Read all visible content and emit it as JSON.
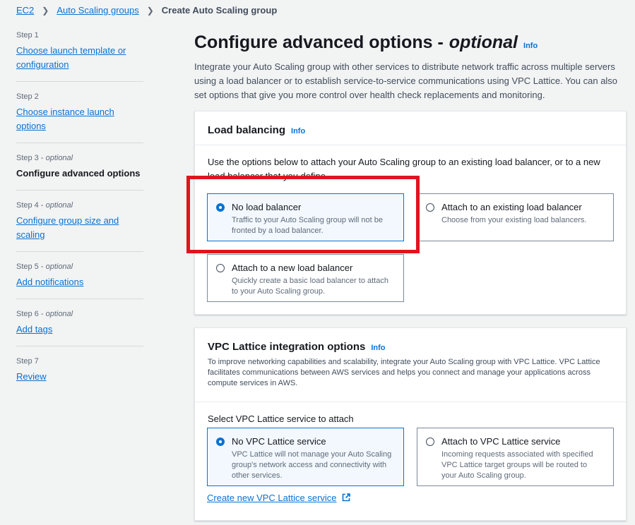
{
  "breadcrumb": {
    "items": [
      "EC2",
      "Auto Scaling groups"
    ],
    "current": "Create Auto Scaling group"
  },
  "steps": [
    {
      "num": "Step 1",
      "optional": "",
      "label": "Choose launch template or configuration"
    },
    {
      "num": "Step 2",
      "optional": "",
      "label": "Choose instance launch options"
    },
    {
      "num": "Step 3 - ",
      "optional": "optional",
      "label": "Configure advanced options"
    },
    {
      "num": "Step 4 - ",
      "optional": "optional",
      "label": "Configure group size and scaling"
    },
    {
      "num": "Step 5 - ",
      "optional": "optional",
      "label": "Add notifications"
    },
    {
      "num": "Step 6 - ",
      "optional": "optional",
      "label": "Add tags"
    },
    {
      "num": "Step 7",
      "optional": "",
      "label": "Review"
    }
  ],
  "page": {
    "title": "Configure advanced options -",
    "title_optional": "optional",
    "info": "Info",
    "description": "Integrate your Auto Scaling group with other services to distribute network traffic across multiple servers using a load balancer or to establish service-to-service communications using VPC Lattice. You can also set options that give you more control over health check replacements and monitoring."
  },
  "load_balancing": {
    "title": "Load balancing",
    "info": "Info",
    "intro": "Use the options below to attach your Auto Scaling group to an existing load balancer, or to a new load balancer that you define.",
    "options": [
      {
        "title": "No load balancer",
        "desc": "Traffic to your Auto Scaling group will not be fronted by a load balancer.",
        "selected": true
      },
      {
        "title": "Attach to an existing load balancer",
        "desc": "Choose from your existing load balancers.",
        "selected": false
      },
      {
        "title": "Attach to a new load balancer",
        "desc": "Quickly create a basic load balancer to attach to your Auto Scaling group.",
        "selected": false
      }
    ]
  },
  "vpc_lattice": {
    "title": "VPC Lattice integration options",
    "info": "Info",
    "description": "To improve networking capabilities and scalability, integrate your Auto Scaling group with VPC Lattice. VPC Lattice facilitates communications between AWS services and helps you connect and manage your applications across compute services in AWS.",
    "select_label": "Select VPC Lattice service to attach",
    "options": [
      {
        "title": "No VPC Lattice service",
        "desc": "VPC Lattice will not manage your Auto Scaling group's network access and connectivity with other services.",
        "selected": true
      },
      {
        "title": "Attach to VPC Lattice service",
        "desc": "Incoming requests associated with specified VPC Lattice target groups will be routed to your Auto Scaling group.",
        "selected": false
      }
    ],
    "create_link": "Create new VPC Lattice service"
  },
  "colors": {
    "accent": "#0972d3",
    "highlight": "#e0141e"
  }
}
